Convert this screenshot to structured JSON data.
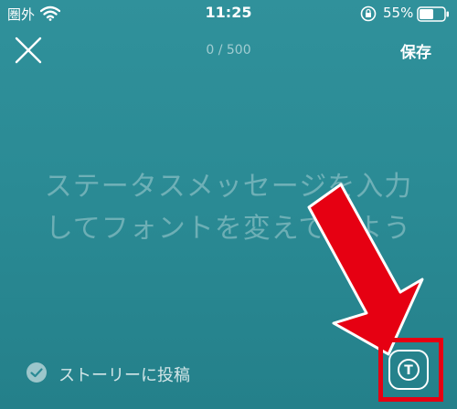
{
  "status_bar": {
    "carrier": "圏外",
    "time": "11:25",
    "battery": "55%",
    "icons": [
      "wifi-icon",
      "orientation-lock-icon",
      "battery-icon"
    ]
  },
  "header": {
    "close_icon": "close-icon",
    "counter": "0 / 500",
    "save_label": "保存"
  },
  "editor": {
    "placeholder_line1": "ステータスメッセージを入力",
    "placeholder_line2": "してフォントを変えてみよう"
  },
  "footer": {
    "story_label": "ストーリーに投稿",
    "story_icon": "check-circle-icon",
    "font_button_icon": "text-style-icon",
    "font_button_glyph": "T"
  },
  "annotation": {
    "color": "#e60012",
    "icon": "arrow-icon"
  }
}
